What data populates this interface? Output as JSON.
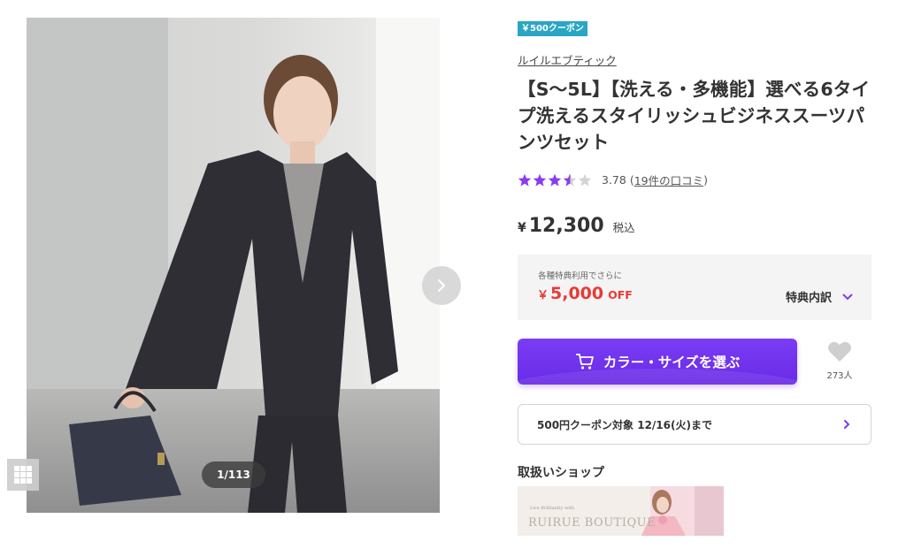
{
  "gallery": {
    "counter": "1/113",
    "icons": {
      "next": "chevron-right-icon",
      "grid": "grid-icon"
    }
  },
  "product": {
    "coupon_badge": "￥500クーポン",
    "shop_name": "ルイルエブティック",
    "title": "【S〜5L】【洗える・多機能】選べる6タイプ洗えるスタイリッシュビジネススーツパンツセット",
    "rating": {
      "value": 3.78,
      "value_text": "3.78",
      "review_link": "19件の口コミ"
    },
    "price": {
      "currency": "¥",
      "amount": "12,300",
      "tax": "税込"
    }
  },
  "discount": {
    "note": "各種特典利用でさらに",
    "currency": "￥",
    "amount": "5,000",
    "off": "OFF",
    "benefit_label": "特典内訳"
  },
  "actions": {
    "cta_label": "カラー・サイズを選ぶ",
    "favorite_count": "273人"
  },
  "coupon_row": {
    "text": "500円クーポン対象 12/16(火)まで"
  },
  "shop": {
    "heading": "取扱いショップ",
    "banner_text": "RUIRUE BOUTIQUE",
    "banner_subtext": "Live Brilliantly with"
  },
  "colors": {
    "accent": "#7a3cf5",
    "discount": "#e83a36",
    "badge": "#2aa6c4",
    "star": "#8a3df0"
  }
}
